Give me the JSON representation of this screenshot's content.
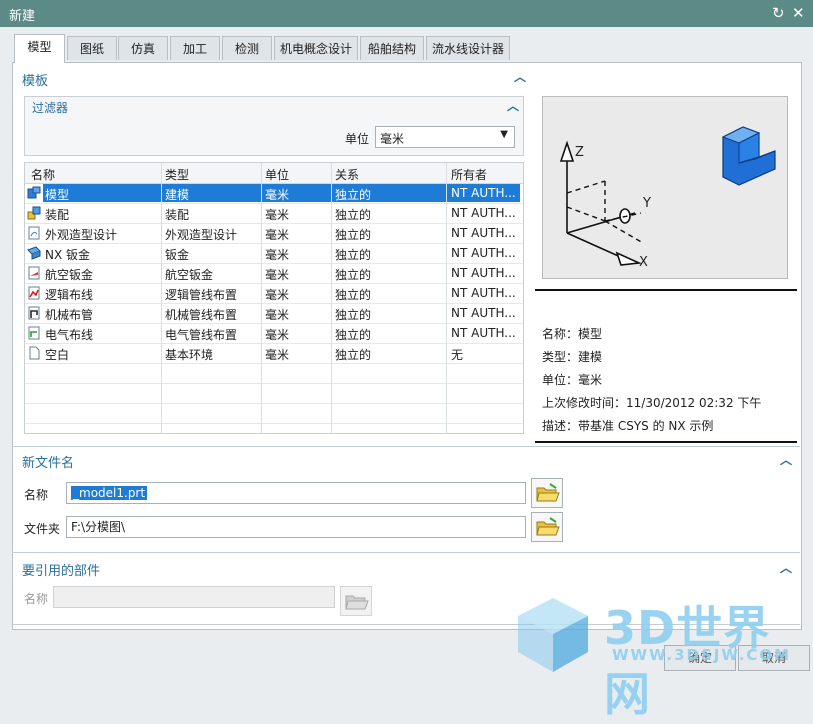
{
  "window": {
    "title": "新建",
    "reset_icon": "refresh-icon",
    "close_icon": "close-icon"
  },
  "tabs": [
    {
      "label": "模型",
      "active": true
    },
    {
      "label": "图纸"
    },
    {
      "label": "仿真"
    },
    {
      "label": "加工"
    },
    {
      "label": "检测"
    },
    {
      "label": "机电概念设计"
    },
    {
      "label": "船舶结构"
    },
    {
      "label": "流水线设计器"
    }
  ],
  "templates": {
    "section_title": "模板",
    "filter_title": "过滤器",
    "unit_label": "单位",
    "unit_value": "毫米",
    "columns": [
      "名称",
      "类型",
      "单位",
      "关系",
      "所有者"
    ],
    "rows": [
      {
        "icon": "model-icon",
        "name": "模型",
        "type": "建模",
        "unit": "毫米",
        "relation": "独立的",
        "owner": "NT AUTH...",
        "selected": true
      },
      {
        "icon": "assembly-icon",
        "name": "装配",
        "type": "装配",
        "unit": "毫米",
        "relation": "独立的",
        "owner": "NT AUTH..."
      },
      {
        "icon": "shape-studio-icon",
        "name": "外观造型设计",
        "type": "外观造型设计",
        "unit": "毫米",
        "relation": "独立的",
        "owner": "NT AUTH..."
      },
      {
        "icon": "sheet-metal-icon",
        "name": "NX 钣金",
        "type": "钣金",
        "unit": "毫米",
        "relation": "独立的",
        "owner": "NT AUTH..."
      },
      {
        "icon": "aero-sheet-metal-icon",
        "name": "航空钣金",
        "type": "航空钣金",
        "unit": "毫米",
        "relation": "独立的",
        "owner": "NT AUTH..."
      },
      {
        "icon": "logic-routing-icon",
        "name": "逻辑布线",
        "type": "逻辑管线布置",
        "unit": "毫米",
        "relation": "独立的",
        "owner": "NT AUTH..."
      },
      {
        "icon": "mech-routing-icon",
        "name": "机械布管",
        "type": "机械管线布置",
        "unit": "毫米",
        "relation": "独立的",
        "owner": "NT AUTH..."
      },
      {
        "icon": "elec-routing-icon",
        "name": "电气布线",
        "type": "电气管线布置",
        "unit": "毫米",
        "relation": "独立的",
        "owner": "NT AUTH..."
      },
      {
        "icon": "blank-icon",
        "name": "空白",
        "type": "基本环境",
        "unit": "毫米",
        "relation": "独立的",
        "owner": "无"
      }
    ]
  },
  "preview": {
    "axis_z": "Z",
    "axis_y": "Y",
    "axis_x": "X",
    "name_label": "名称：",
    "name_value": "模型",
    "type_label": "类型：",
    "type_value": "建模",
    "unit_label": "单位：",
    "unit_value": "毫米",
    "modified_label": "上次修改时间：",
    "modified_value": "11/30/2012 02:32 下午",
    "desc_label": "描述：",
    "desc_value": "带基准 CSYS 的 NX 示例"
  },
  "new_file": {
    "section_title": "新文件名",
    "name_label": "名称",
    "name_value": "_model1.prt",
    "folder_label": "文件夹",
    "folder_value": "F:\\分模图\\"
  },
  "refs": {
    "section_title": "要引用的部件",
    "name_label": "名称",
    "name_value": ""
  },
  "buttons": {
    "ok": "确定",
    "cancel": "取消"
  },
  "watermark": {
    "text": "3D世界网",
    "url": "WWW.3DSJW.COM"
  },
  "colors": {
    "titlebar": "#5c8a86",
    "accent": "#2a6f9c",
    "selection": "#1e7bd6"
  }
}
